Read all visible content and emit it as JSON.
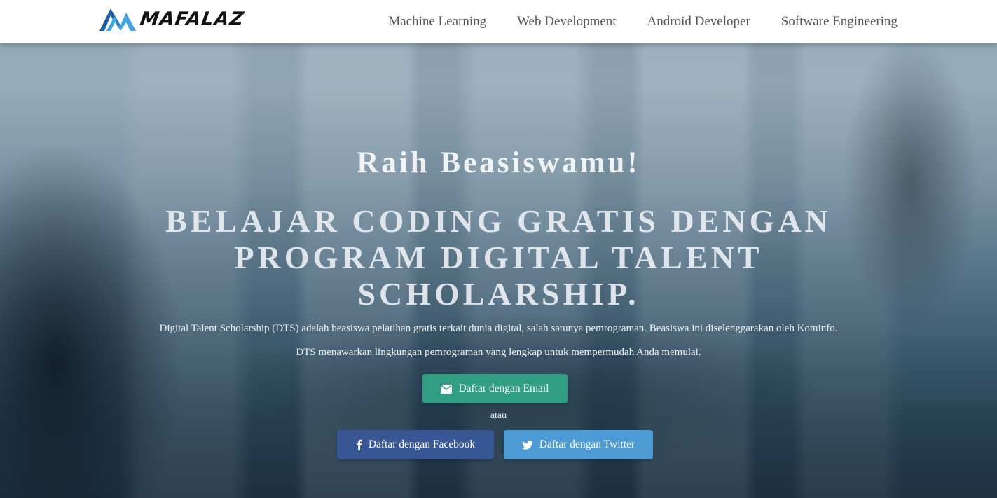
{
  "brand": {
    "name": "MAFALAZ",
    "logo_icon": "mountain-m-logo",
    "colors": {
      "blue_dark": "#1b5fa8",
      "blue_light": "#42a5e0"
    }
  },
  "nav": {
    "items": [
      {
        "label": "Machine Learning"
      },
      {
        "label": "Web Development"
      },
      {
        "label": "Android Developer"
      },
      {
        "label": "Software Engineering"
      }
    ]
  },
  "hero": {
    "tagline": "Raih Beasiswamu!",
    "headline_lines": [
      "BELAJAR CODING GRATIS DENGAN",
      "PROGRAM DIGITAL TALENT",
      "SCHOLARSHIP."
    ],
    "description_1": "Digital Talent Scholarship (DTS) adalah beasiswa pelatihan gratis terkait dunia digital, salah satunya pemrograman. Beasiswa ini diselenggarakan oleh Kominfo.",
    "description_2": "DTS menawarkan lingkungan pemrograman yang lengkap untuk mempermudah Anda memulai.",
    "separator": "atau",
    "buttons": {
      "email": {
        "label": "Daftar dengan Email",
        "icon": "envelope-icon",
        "color": "#2f9e82"
      },
      "facebook": {
        "label": "Daftar dengan Facebook",
        "icon": "facebook-icon",
        "color": "#3a5795"
      },
      "twitter": {
        "label": "Daftar dengan Twitter",
        "icon": "twitter-icon",
        "color": "#4d9ad5"
      }
    }
  }
}
